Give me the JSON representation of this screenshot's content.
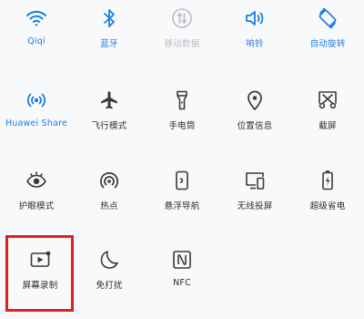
{
  "colors": {
    "active": "#1a7fe0",
    "inactive": "#2e2e2e",
    "disabled": "#b9bcc2",
    "highlight_border": "#e02020"
  },
  "tiles": [
    {
      "label": "Qiqi",
      "icon": "wifi-icon",
      "state": "on"
    },
    {
      "label": "蓝牙",
      "icon": "bluetooth-icon",
      "state": "on"
    },
    {
      "label": "移动数据",
      "icon": "mobile-data-icon",
      "state": "disabled"
    },
    {
      "label": "响铃",
      "icon": "speaker-icon",
      "state": "on"
    },
    {
      "label": "自动旋转",
      "icon": "auto-rotate-icon",
      "state": "on"
    },
    {
      "label": "Huawei Share",
      "icon": "huawei-share-icon",
      "state": "on"
    },
    {
      "label": "飞行模式",
      "icon": "airplane-icon",
      "state": "off"
    },
    {
      "label": "手电筒",
      "icon": "flashlight-icon",
      "state": "off"
    },
    {
      "label": "位置信息",
      "icon": "location-pin-icon",
      "state": "off"
    },
    {
      "label": "截屏",
      "icon": "screenshot-scissors-icon",
      "state": "off"
    },
    {
      "label": "护眼模式",
      "icon": "eye-icon",
      "state": "off"
    },
    {
      "label": "热点",
      "icon": "hotspot-icon",
      "state": "off"
    },
    {
      "label": "悬浮导航",
      "icon": "floating-nav-icon",
      "state": "off"
    },
    {
      "label": "无线投屏",
      "icon": "wireless-projection-icon",
      "state": "off"
    },
    {
      "label": "超级省电",
      "icon": "battery-saver-icon",
      "state": "off"
    },
    {
      "label": "屏幕录制",
      "icon": "screen-record-icon",
      "state": "off"
    },
    {
      "label": "免打扰",
      "icon": "moon-icon",
      "state": "off"
    },
    {
      "label": "NFC",
      "icon": "nfc-icon",
      "state": "off"
    }
  ]
}
